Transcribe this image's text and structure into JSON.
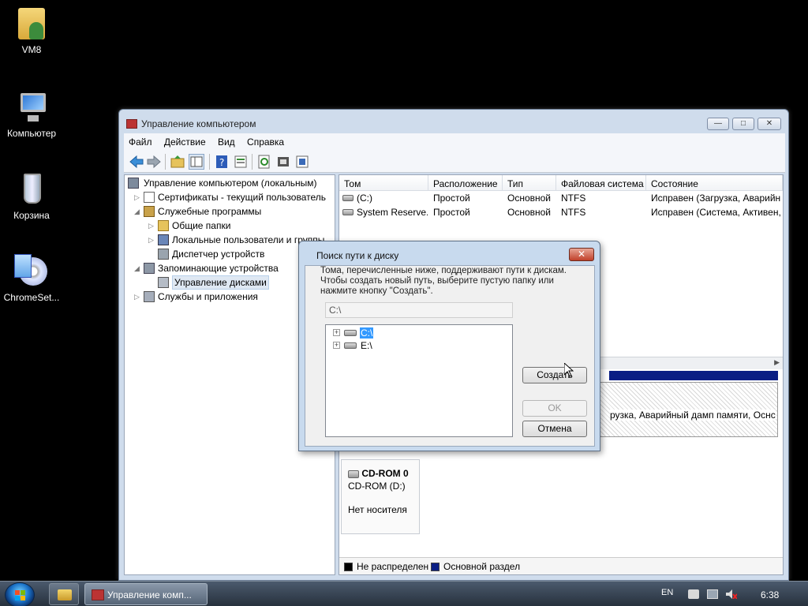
{
  "desktop": {
    "icons": [
      {
        "label": "VM8"
      },
      {
        "label": "Компьютер"
      },
      {
        "label": "Корзина"
      },
      {
        "label": "ChromeSet..."
      }
    ]
  },
  "window": {
    "title": "Управление компьютером",
    "menu": [
      "Файл",
      "Действие",
      "Вид",
      "Справка"
    ],
    "controls": {
      "minimize": "—",
      "maximize": "□",
      "close": "✕"
    }
  },
  "tree": {
    "items": [
      {
        "label": "Управление компьютером (локальным)",
        "icon": "computer-management-icon"
      },
      {
        "label": "Сертификаты - текущий пользователь",
        "icon": "certificates-icon"
      },
      {
        "label": "Служебные программы",
        "icon": "tools-icon"
      },
      {
        "label": "Общие папки",
        "icon": "shared-folders-icon"
      },
      {
        "label": "Локальные пользователи и группы",
        "icon": "users-icon"
      },
      {
        "label": "Диспетчер устройств",
        "icon": "device-manager-icon"
      },
      {
        "label": "Запоминающие устройства",
        "icon": "storage-icon"
      },
      {
        "label": "Управление дисками",
        "icon": "disk-management-icon"
      },
      {
        "label": "Службы и приложения",
        "icon": "services-icon"
      }
    ]
  },
  "volumes": {
    "columns": [
      "Том",
      "Расположение",
      "Тип",
      "Файловая система",
      "Состояние"
    ],
    "rows": [
      [
        "(C:)",
        "Простой",
        "Основной",
        "NTFS",
        "Исправен (Загрузка, Аварийн"
      ],
      [
        "System Reserve...",
        "Простой",
        "Основной",
        "NTFS",
        "Исправен (Система, Активен,"
      ]
    ]
  },
  "disk_view": {
    "partition_text": "рузка, Аварийный дамп памяти, Оснс",
    "cdrom": {
      "name": "CD-ROM 0",
      "drive": "CD-ROM (D:)",
      "status": "Нет носителя"
    },
    "legend": [
      {
        "label": "Не распределен",
        "color": "#000000"
      },
      {
        "label": "Основной раздел",
        "color": "#0a1e84"
      }
    ]
  },
  "dialog": {
    "title": "Поиск пути к диску",
    "close": "✕",
    "description": "Тома, перечисленные ниже, поддерживают пути к дискам. Чтобы создать новый путь, выберите пустую папку или нажмите кнопку \"Создать\".",
    "path_value": "C:\\",
    "drives": [
      {
        "label": "C:\\",
        "selected": true
      },
      {
        "label": "E:\\",
        "selected": false
      }
    ],
    "buttons": {
      "create": "Создать",
      "ok": "OK",
      "cancel": "Отмена"
    }
  },
  "taskbar": {
    "task_label": "Управление комп...",
    "language": "EN",
    "clock": "6:38"
  }
}
